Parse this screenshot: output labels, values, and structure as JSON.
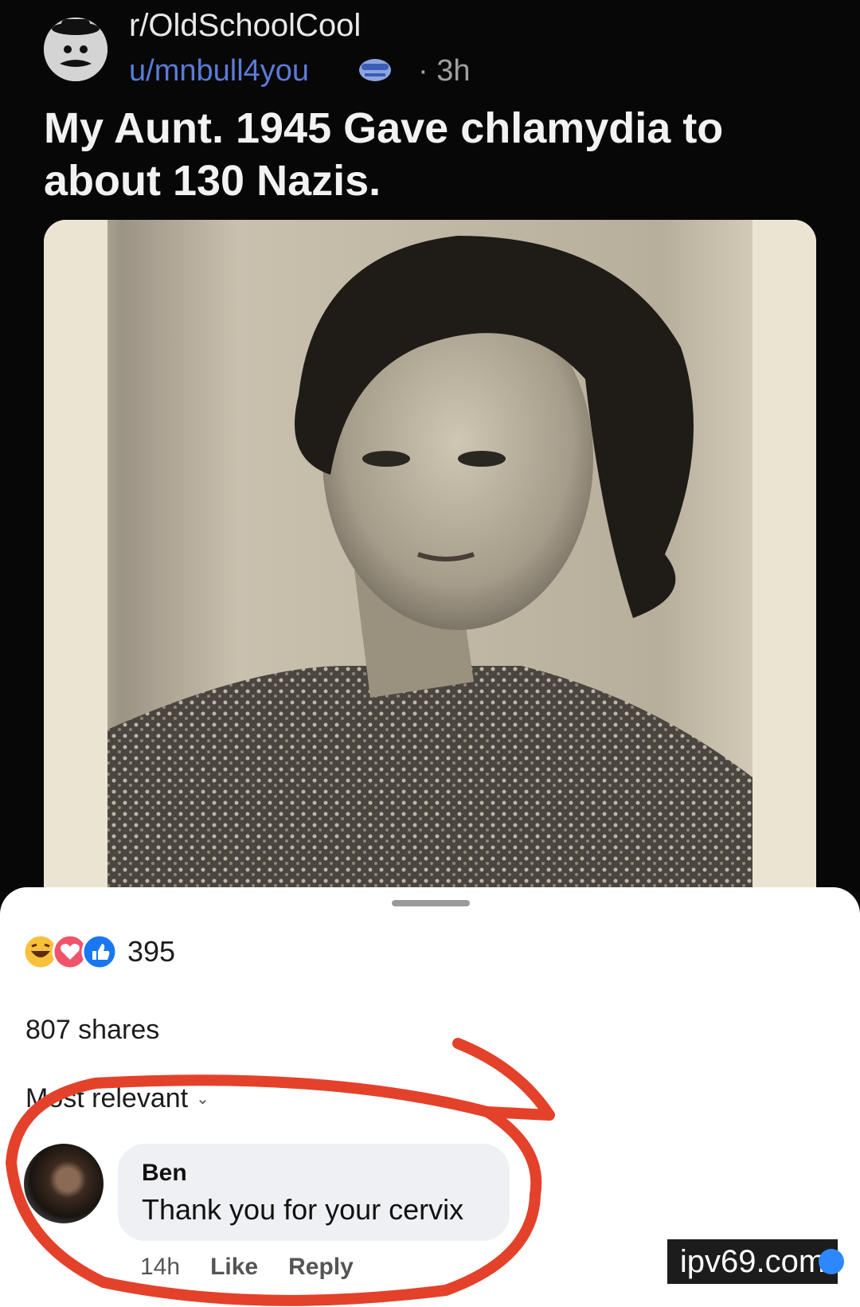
{
  "post": {
    "subreddit": "r/OldSchoolCool",
    "username": "u/mnbull4you",
    "time": "· 3h",
    "title": "My Aunt.  1945  Gave chlamydia to about 130 Nazis."
  },
  "reactions": {
    "count": "395",
    "icons": [
      "laughing-emoji-icon",
      "heart-icon",
      "like-icon"
    ]
  },
  "shares": "807 shares",
  "sort": {
    "label": "Most relevant",
    "icon": "chevron-down-icon"
  },
  "comment": {
    "author": "Ben",
    "text": "Thank you for your cervix",
    "time": "14h",
    "like_label": "Like",
    "reply_label": "Reply"
  },
  "watermark": "ipv69.com",
  "colors": {
    "background": "#070707",
    "username": "#5b7bd6",
    "annotation_circle": "#e4412b",
    "sheet": "#ffffff",
    "comment_bubble": "#eff0f3"
  }
}
